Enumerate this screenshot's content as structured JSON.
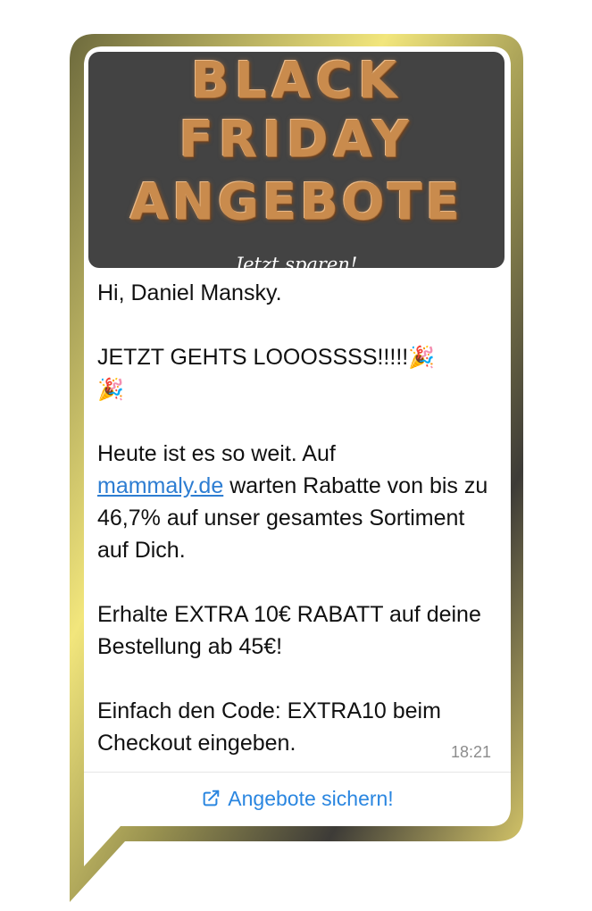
{
  "banner": {
    "line1": "BLACK",
    "line2": "FRIDAY",
    "line3": "ANGEBOTE",
    "subtitle": "Jetzt sparen!"
  },
  "message": {
    "greeting": "Hi, Daniel Mansky.",
    "headline": "JETZT GEHTS LOOOSSSS!!!!!",
    "party_emoji_1": "🎉",
    "party_emoji_2": "🎉",
    "para1_a": "Heute ist es so weit. Auf",
    "para1_link": "mammaly.de",
    "para1_b": " warten Rabatte von bis zu 46,7%  auf unser gesamtes Sortiment auf Dich.",
    "para2": "Erhalte  EXTRA 10€ RABATT auf deine Bestellung ab 45€!",
    "para3": "Einfach den Code:  EXTRA10  beim Checkout eingeben.",
    "time": "18:21"
  },
  "action": {
    "label": "Angebote sichern!",
    "icon": "external-link-icon"
  },
  "colors": {
    "link": "#2d7dd2",
    "action": "#2a86e0",
    "banner_bg": "#434343",
    "frame_gold": "#efe27a",
    "frame_dark": "#3a3a3a"
  }
}
